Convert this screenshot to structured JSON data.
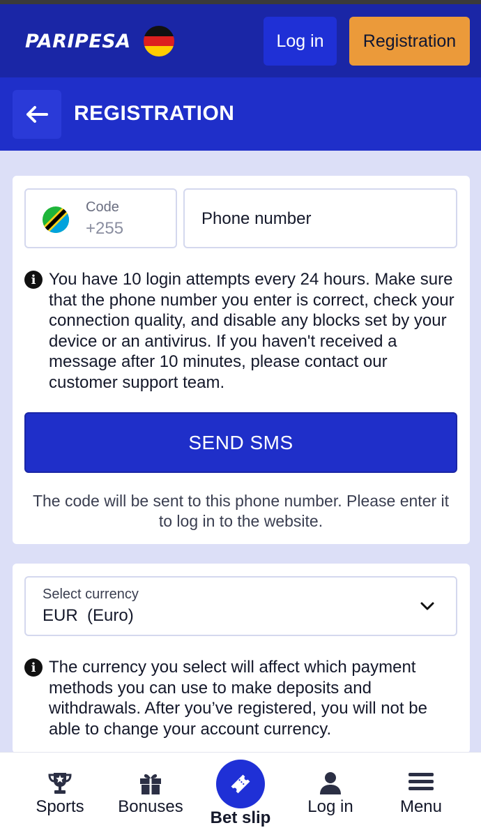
{
  "header": {
    "logo_text": "PARIPESA",
    "login_label": "Log in",
    "registration_label": "Registration"
  },
  "titlebar": {
    "title": "REGISTRATION"
  },
  "phone_form": {
    "code_label": "Code",
    "code_value": "+255",
    "phone_placeholder": "Phone number",
    "info_text": "You have 10 login attempts every 24 hours. Make sure that the phone number you enter is correct, check your connection quality, and disable any blocks set by your device or an antivirus. If you haven't received a message after 10 minutes, please contact our customer support team.",
    "send_button": "SEND SMS",
    "send_note": "The code will be sent to this phone number. Please enter it to log in to the website."
  },
  "currency_form": {
    "label": "Select currency",
    "selected": "EUR  (Euro)",
    "info_text": "The currency you select will affect which payment methods you can use to make deposits and withdrawals. After you’ve registered, you will not be able to change your account currency."
  },
  "bottom_nav": {
    "sports": "Sports",
    "bonuses": "Bonuses",
    "bet_slip": "Bet slip",
    "login": "Log in",
    "menu": "Menu"
  },
  "colors": {
    "header_bg": "#1a26a6",
    "titlebar_bg": "#1f2fc9",
    "primary_button": "#1f2fc9",
    "registration_button": "#eb9a3a",
    "page_bg": "#dcdff7"
  },
  "icons": {
    "header_flag": "germany-flag-icon",
    "code_flag": "tanzania-flag-icon",
    "back": "arrow-left-icon",
    "info": "info-icon",
    "dropdown": "chevron-down-icon",
    "sports": "trophy-icon",
    "bonuses": "gift-icon",
    "bet_slip": "ticket-icon",
    "login": "user-icon",
    "menu": "hamburger-menu-icon"
  }
}
